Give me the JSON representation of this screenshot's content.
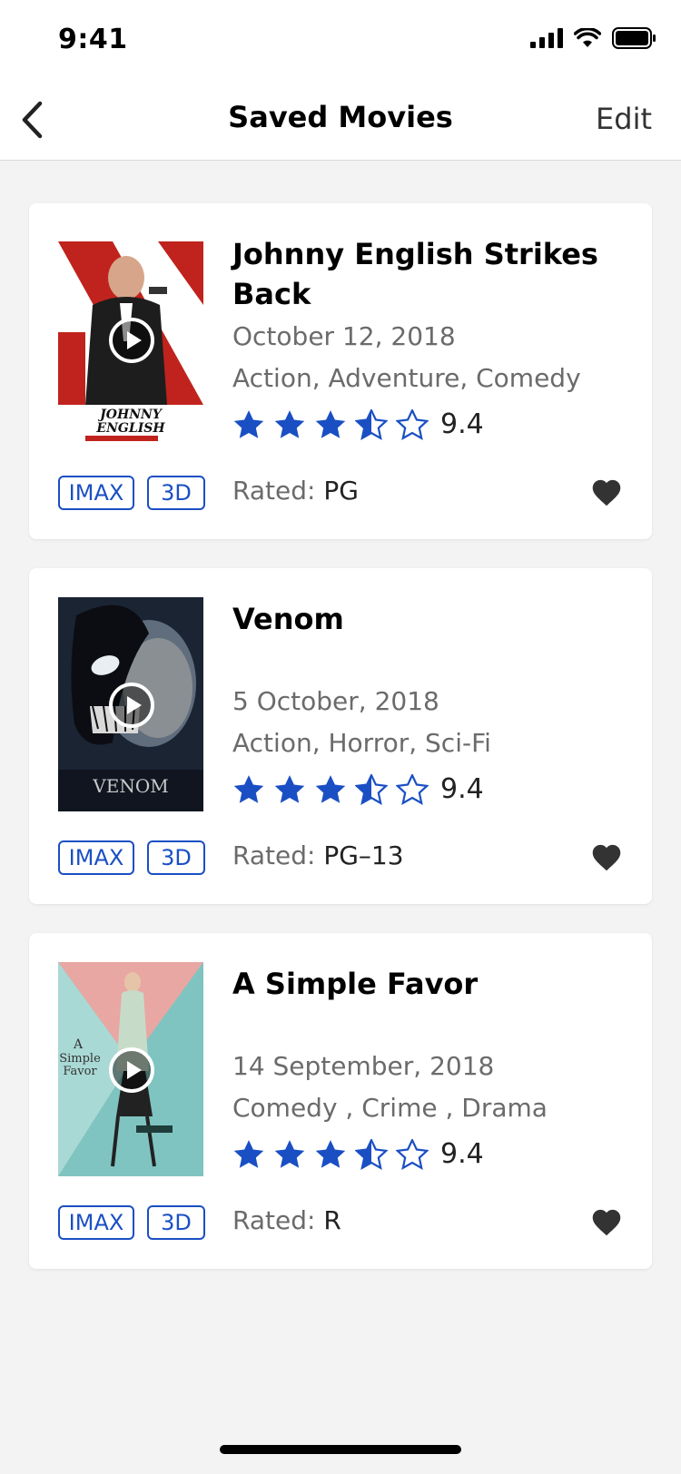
{
  "status": {
    "time": "9:41"
  },
  "nav": {
    "title": "Saved Movies",
    "edit_label": "Edit",
    "back_icon": "chevron-left-icon"
  },
  "colors": {
    "accent": "#1a4fc4",
    "star": "#1a4fc4",
    "heart": "#333333",
    "background": "#f3f3f3"
  },
  "movies": [
    {
      "title": "Johnny English Strikes Back",
      "date": "October 12, 2018",
      "genres": "Action, Adventure, Comedy",
      "rating": "9.4",
      "stars": 3.5,
      "badges": [
        "IMAX",
        "3D"
      ],
      "rated_label": "Rated:",
      "rated_value": "PG"
    },
    {
      "title": "Venom",
      "date": "5 October, 2018",
      "genres": "Action, Horror, Sci-Fi",
      "rating": "9.4",
      "stars": 3.5,
      "badges": [
        "IMAX",
        "3D"
      ],
      "rated_label": "Rated:",
      "rated_value": "PG–13"
    },
    {
      "title": "A Simple Favor",
      "date": "14 September, 2018",
      "genres": "Comedy , Crime , Drama",
      "rating": "9.4",
      "stars": 3.5,
      "badges": [
        "IMAX",
        "3D"
      ],
      "rated_label": "Rated:",
      "rated_value": "R"
    }
  ]
}
